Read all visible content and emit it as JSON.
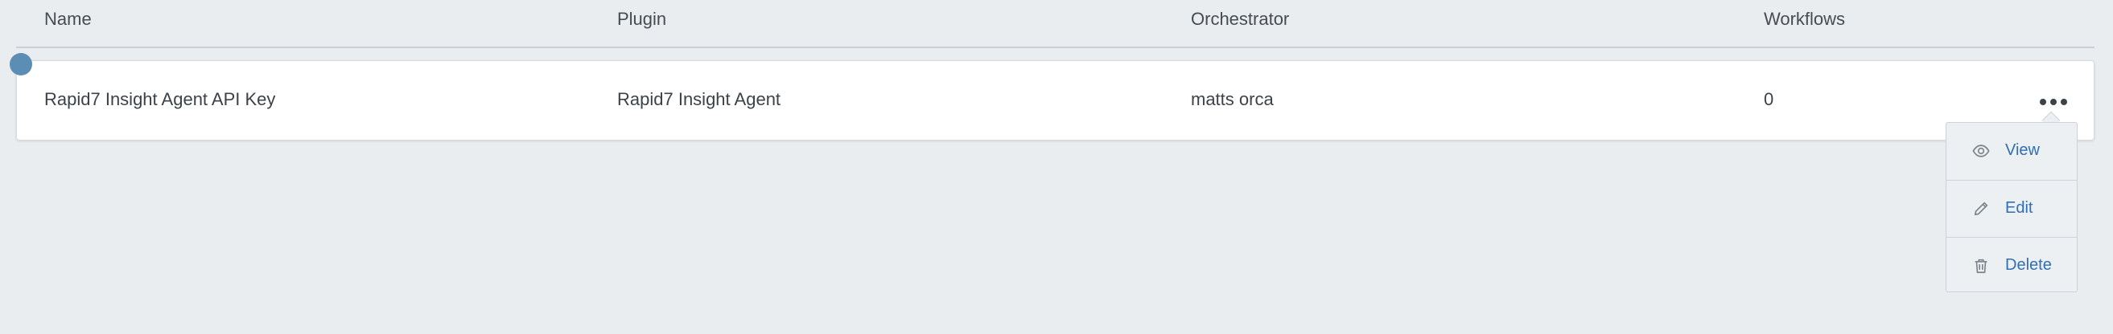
{
  "table": {
    "columns": [
      "Name",
      "Plugin",
      "Orchestrator",
      "Workflows"
    ],
    "rows": [
      {
        "name": "Rapid7 Insight Agent API Key",
        "plugin": "Rapid7 Insight Agent",
        "orchestrator": "matts orca",
        "workflows": "0"
      }
    ]
  },
  "row_menu": {
    "items": [
      {
        "label": "View",
        "icon": "eye-icon"
      },
      {
        "label": "Edit",
        "icon": "pencil-icon"
      },
      {
        "label": "Delete",
        "icon": "trash-icon"
      }
    ]
  },
  "colors": {
    "background": "#e9edf0",
    "link": "#2f6fb3",
    "selection_dot": "#5b8db5"
  }
}
